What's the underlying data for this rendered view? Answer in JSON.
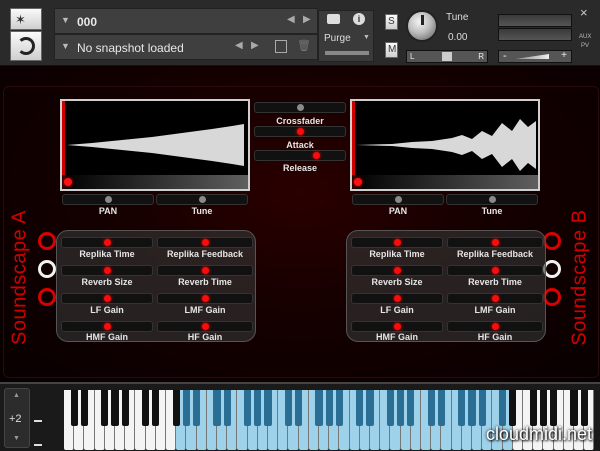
{
  "header": {
    "instrument_name": "000",
    "snapshot": "No snapshot loaded",
    "purge_label": "Purge",
    "solo_label": "S",
    "mute_label": "M",
    "tune_label": "Tune",
    "tune_value": "0.00",
    "left_label": "L",
    "right_label": "R",
    "aux_label": "AUX",
    "pv_label": "PV",
    "close_glyph": "×",
    "minus_glyph": "-",
    "plus_glyph": "+"
  },
  "center": {
    "crossfader_label": "Crossfader",
    "attack_label": "Attack",
    "release_label": "Release"
  },
  "soundscape_a": {
    "title": "Soundscape A",
    "pan_label": "PAN",
    "tune_label": "Tune",
    "fx": [
      "Replika Time",
      "Replika Feedback",
      "Reverb Size",
      "Reverb Time",
      "LF Gain",
      "LMF Gain",
      "HMF Gain",
      "HF Gain"
    ]
  },
  "soundscape_b": {
    "title": "Soundscape B",
    "pan_label": "PAN",
    "tune_label": "Tune",
    "fx": [
      "Replika Time",
      "Replika Feedback",
      "Reverb Size",
      "Reverb Time",
      "LF Gain",
      "LMF Gain",
      "HMF Gain",
      "HF Gain"
    ]
  },
  "keyboard": {
    "octave_value": "+2",
    "up_glyph": "▲",
    "down_glyph": "▼",
    "watermark": "cloudmidi.net"
  },
  "colors": {
    "accent_red": "#ff0a0a",
    "active_key": "#9ed1ea",
    "panel_bg": "#150000"
  }
}
